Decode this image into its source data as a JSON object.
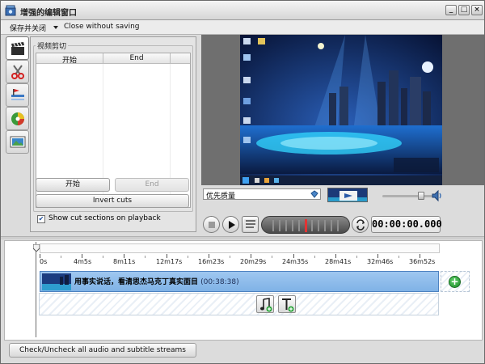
{
  "window": {
    "title": "增强的编辑窗口",
    "controls": {
      "minimize": "_",
      "maximize": "□",
      "close": "×"
    }
  },
  "menu": {
    "save_close": "保存并关闭",
    "close_without_saving": "Close without saving"
  },
  "tools": [
    {
      "name": "clapperboard-icon"
    },
    {
      "name": "scissors-icon"
    },
    {
      "name": "flag-icon"
    },
    {
      "name": "color-palette-icon"
    },
    {
      "name": "picture-icon"
    }
  ],
  "cut_panel": {
    "group_title": "视频剪切",
    "columns": [
      "开始",
      "End"
    ],
    "rows": [],
    "start_button": "开始",
    "end_button": "End",
    "invert_button": "Invert cuts",
    "show_cut_label": "Show cut sections on playback",
    "show_cut_checked": true
  },
  "preview": {
    "quality_value": "优先质量",
    "volume_level": 0.78,
    "timecode": "00:00:00.000"
  },
  "timeline": {
    "ticks": [
      "0s",
      "4m5s",
      "8m11s",
      "12m17s",
      "16m23s",
      "20m29s",
      "24m35s",
      "28m41s",
      "32m46s",
      "36m52s"
    ],
    "clip": {
      "title": "用事实说话，看清思杰马克丁真实面目",
      "duration": "(00:38:38)"
    }
  },
  "bottom": {
    "check_streams_button": "Check/Uncheck all audio and subtitle streams"
  },
  "colors": {
    "clip_fill": "#8dbbec",
    "clip_border": "#4d82c0",
    "add_green": "#1d8a2b",
    "window_bg": "#dcdcdc"
  }
}
